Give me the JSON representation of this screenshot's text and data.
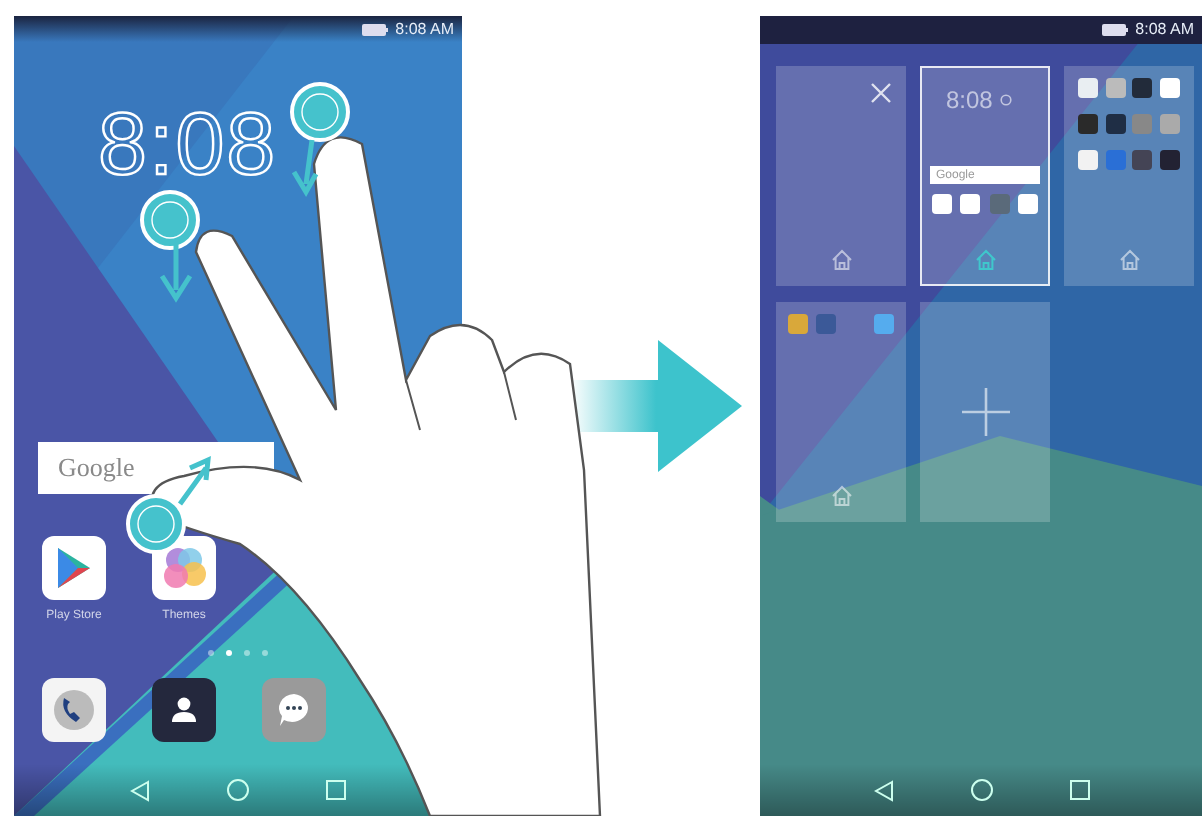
{
  "left_phone": {
    "status_time": "8:08 AM",
    "clock": "8:08",
    "search": {
      "placeholder": "Google"
    },
    "apps": [
      {
        "label": "Play Store"
      },
      {
        "label": "Themes"
      }
    ],
    "page_dots": [
      {
        "selected": false
      },
      {
        "selected": true
      },
      {
        "selected": false
      },
      {
        "selected": false
      }
    ]
  },
  "right_phone": {
    "status_time": "8:08 AM",
    "pages": [
      {
        "kind": "empty",
        "selected": false
      },
      {
        "kind": "home",
        "selected": true,
        "clock": "8:08",
        "search": "Google"
      },
      {
        "kind": "apps",
        "selected": false
      },
      {
        "kind": "social",
        "selected": false
      },
      {
        "kind": "add",
        "selected": false
      }
    ]
  }
}
